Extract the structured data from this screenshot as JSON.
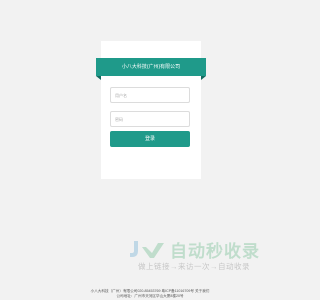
{
  "login": {
    "title": "小八大科技(广州)有限公司",
    "username_placeholder": "用户名",
    "password_placeholder": "密码",
    "submit_label": "登录"
  },
  "watermark": {
    "title": "自动秒收录",
    "subtitle": "做上链接→来访一次→自动收录",
    "logo_icon": "jz-logo-icon"
  },
  "footer": {
    "line1": "小八大科技（广州）有限公司020-85453769 粤ICP备11016709号 关于我们",
    "line2": "公司地址：广州市天河区华山大厦8楼20号"
  },
  "colors": {
    "accent": "#1f9a8a",
    "background": "#f2f2f2"
  }
}
